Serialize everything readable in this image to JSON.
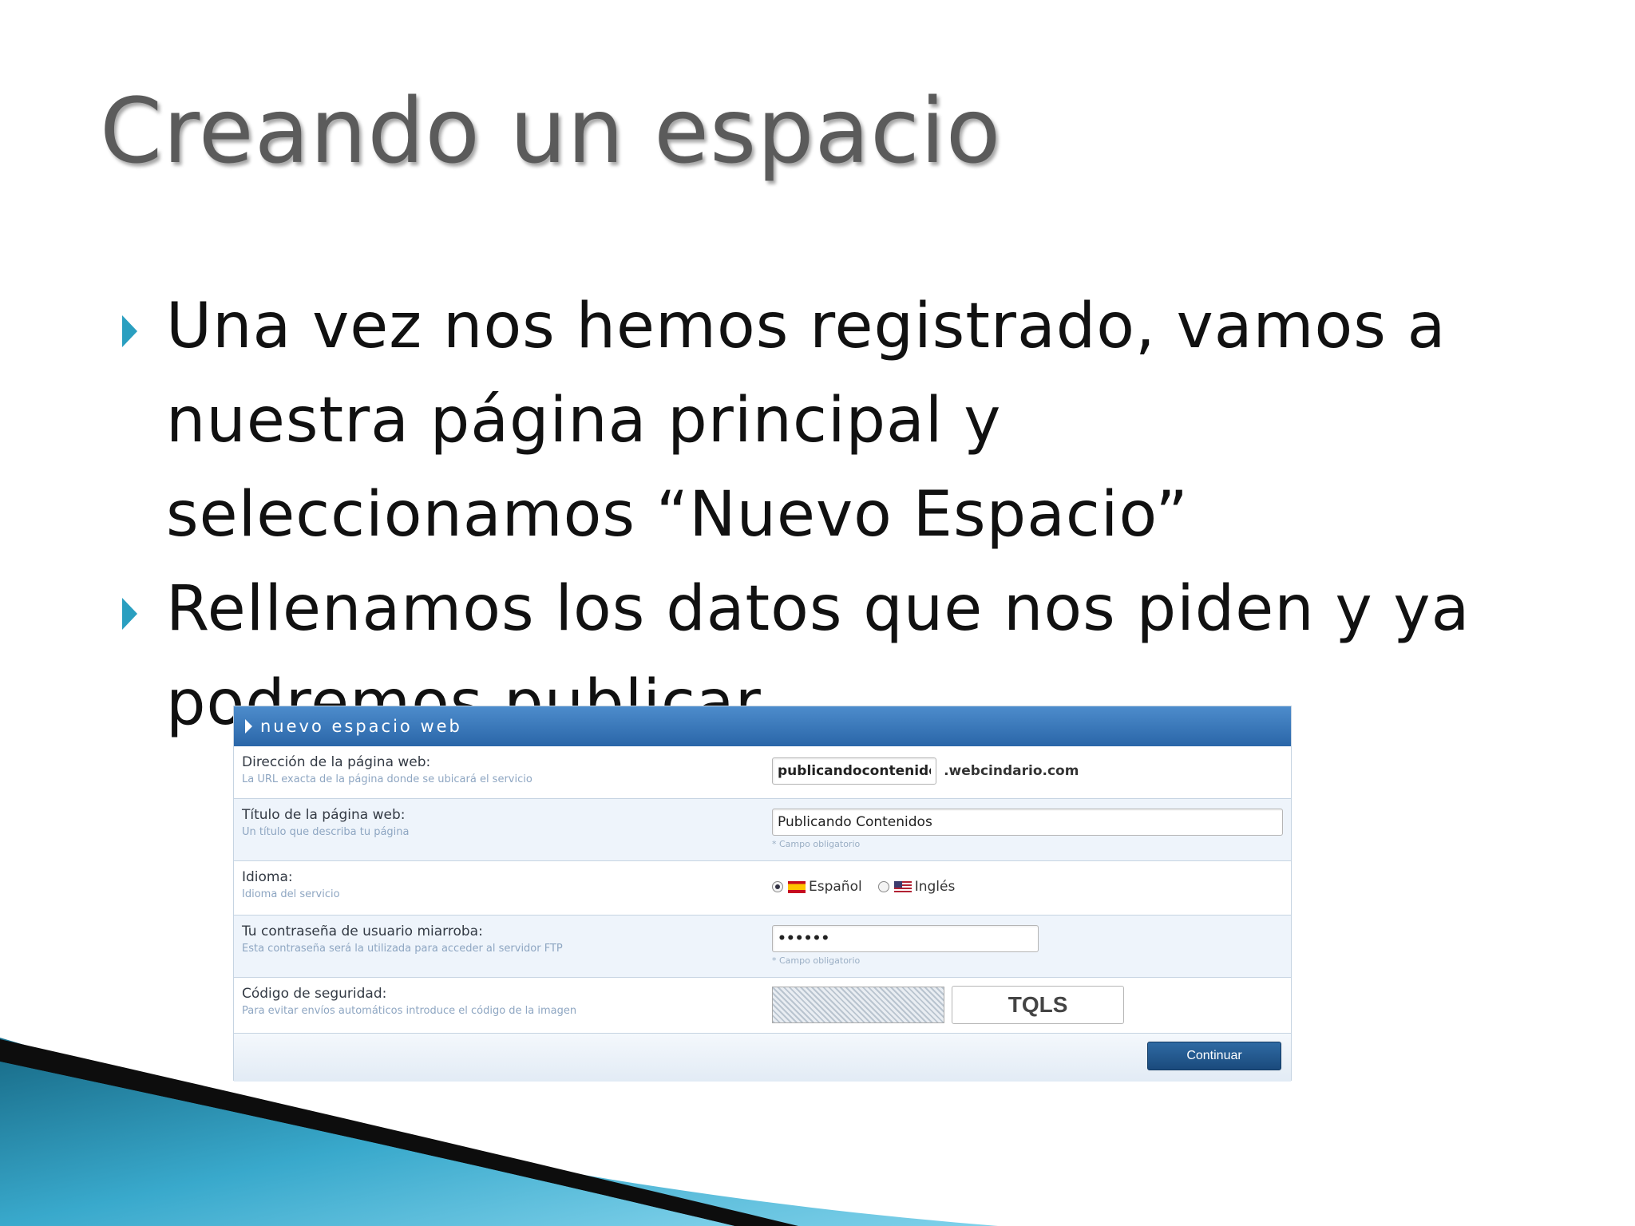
{
  "slide": {
    "title": "Creando un espacio",
    "bullets": [
      {
        "text": "Una vez nos hemos registrado, vamos a nuestra página principal y seleccionamos “Nuevo Espacio”"
      },
      {
        "text": "Rellenamos los datos que nos piden y ya podremos publicar"
      }
    ]
  },
  "form": {
    "header_title": "nuevo espacio web",
    "rows": {
      "address": {
        "label": "Dirección de la página web:",
        "sublabel": "La URL exacta de la página donde se ubicará el servicio",
        "value": "publicandocontenidos",
        "suffix": ".webcindario.com"
      },
      "title": {
        "label": "Título de la página web:",
        "sublabel": "Un título que describa tu página",
        "value": "Publicando Contenidos",
        "hint": "* Campo obligatorio"
      },
      "language": {
        "label": "Idioma:",
        "sublabel": "Idioma del servicio",
        "options": [
          "Español",
          "Inglés"
        ],
        "selected": "Español"
      },
      "password": {
        "label": "Tu contraseña de usuario miarroba:",
        "sublabel": "Esta contraseña será la utilizada para acceder al servidor FTP",
        "value": "••••••",
        "hint": "* Campo obligatorio"
      },
      "captcha": {
        "label": "Código de seguridad:",
        "sublabel": "Para evitar envíos automáticos introduce el código de la imagen",
        "value": "TQLS"
      }
    },
    "continue_label": "Continuar"
  },
  "colors": {
    "accent": "#2a9fc0",
    "header_blue": "#2a66a8",
    "button_blue": "#1a4a7c"
  }
}
